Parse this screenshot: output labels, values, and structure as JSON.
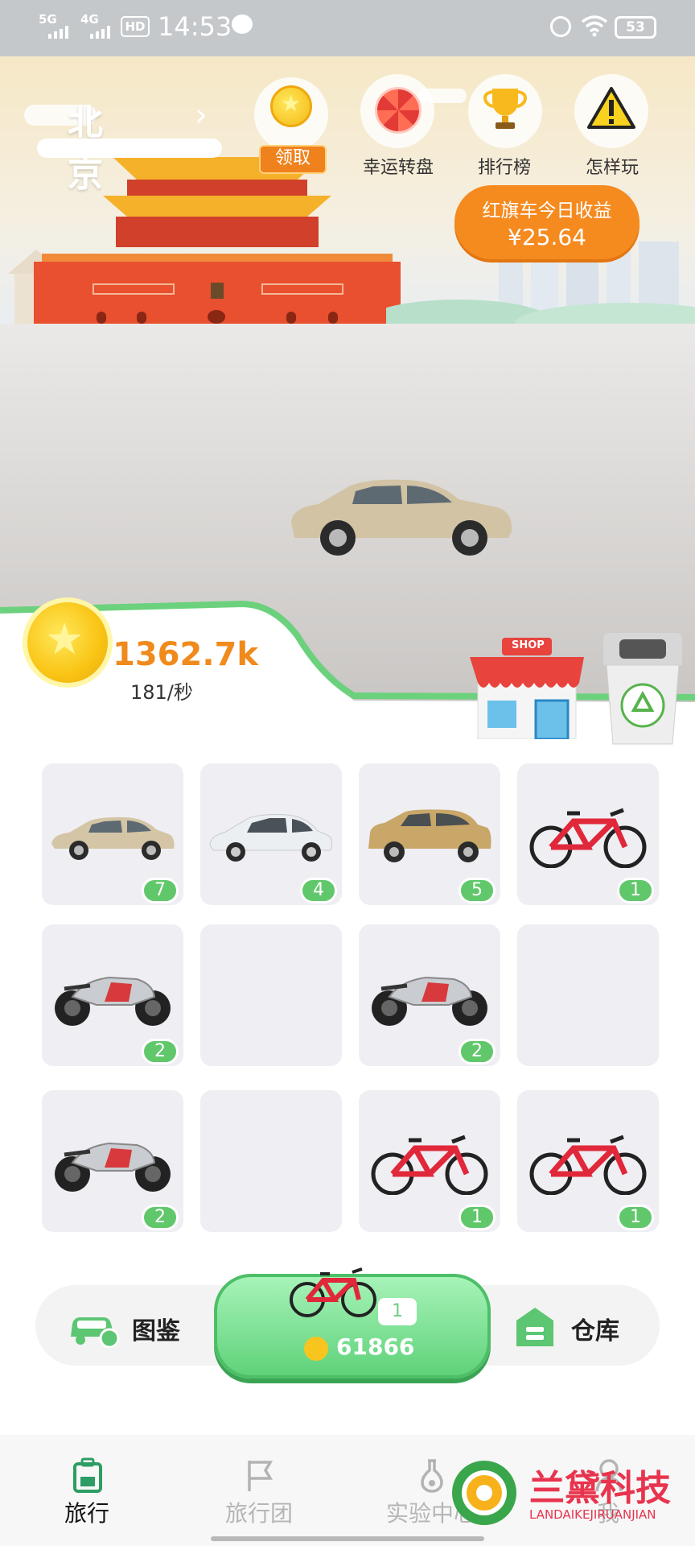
{
  "status_bar": {
    "network_1": "5G",
    "network_2": "4G",
    "hd_label": "HD",
    "time": "14:53",
    "battery": "53"
  },
  "header": {
    "city": "北京",
    "claim_label": "领取",
    "buttons": [
      {
        "label": "幸运转盘",
        "icon": "wheel-icon"
      },
      {
        "label": "排行榜",
        "icon": "trophy-icon"
      },
      {
        "label": "怎样玩",
        "icon": "warning-icon"
      }
    ],
    "earnings_title": "红旗车今日收益",
    "earnings_value": "¥25.64"
  },
  "shop_sign": "SHOP",
  "coins": {
    "total": "1362.7k",
    "rate": "181/秒"
  },
  "grid": [
    {
      "vehicle": "sedan-beige",
      "level": "7"
    },
    {
      "vehicle": "sedan-white",
      "level": "4"
    },
    {
      "vehicle": "suv-gold",
      "level": "5"
    },
    {
      "vehicle": "bicycle-red",
      "level": "1"
    },
    {
      "vehicle": "motorcycle",
      "level": "2"
    },
    {
      "vehicle": "",
      "level": ""
    },
    {
      "vehicle": "motorcycle",
      "level": "2"
    },
    {
      "vehicle": "",
      "level": ""
    },
    {
      "vehicle": "motorcycle",
      "level": "2"
    },
    {
      "vehicle": "",
      "level": ""
    },
    {
      "vehicle": "bicycle-red",
      "level": "1"
    },
    {
      "vehicle": "bicycle-red",
      "level": "1"
    }
  ],
  "actions": {
    "catalog_label": "图鉴",
    "buy_level": "1",
    "buy_price": "61866",
    "storage_label": "仓库"
  },
  "tabs": [
    {
      "label": "旅行",
      "active": true
    },
    {
      "label": "旅行团",
      "active": false
    },
    {
      "label": "实验中心",
      "active": false
    },
    {
      "label": "我",
      "active": false
    }
  ],
  "watermark": {
    "title": "兰黛科技",
    "subtitle": "LANDAIKEJIRUANJIAN"
  },
  "colors": {
    "accent_green": "#61c76b",
    "accent_orange": "#f58a1f",
    "coin_gold": "#f9c414"
  }
}
